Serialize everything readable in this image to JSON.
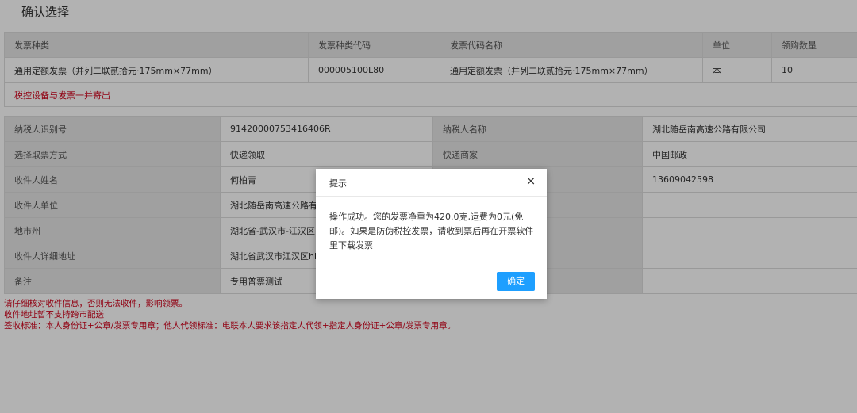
{
  "section": {
    "title": "确认选择"
  },
  "invoice_table": {
    "headers": [
      "发票种类",
      "发票种类代码",
      "发票代码名称",
      "单位",
      "领购数量"
    ],
    "rows": [
      [
        "通用定额发票（并列二联贰拾元·175mm×77mm）",
        "000005100L80",
        "通用定额发票（并列二联贰拾元·175mm×77mm）",
        "本",
        "10"
      ]
    ],
    "warning": "税控设备与发票一并寄出"
  },
  "info_table": {
    "rows": [
      {
        "label1": "纳税人识别号",
        "value1": "91420000753416406R",
        "label2": "纳税人名称",
        "value2": "湖北随岳南高速公路有限公司"
      },
      {
        "label1": "选择取票方式",
        "value1": "快递领取",
        "label2": "快递商家",
        "value2": "中国邮政"
      },
      {
        "label1": "收件人姓名",
        "value1": "何柏青",
        "label2": "",
        "value2": "13609042598"
      },
      {
        "label1": "收件人单位",
        "value1": "湖北随岳南高速公路有",
        "label2": "",
        "value2": ""
      },
      {
        "label1": "地市州",
        "value1": "湖北省-武汉市-江汉区",
        "label2": "",
        "value2": ""
      },
      {
        "label1": "收件人详细地址",
        "value1": "湖北省武汉市江汉区hk",
        "label2": "",
        "value2": ""
      },
      {
        "label1": "备注",
        "value1": "专用普票测试",
        "label2": "",
        "value2": ""
      }
    ]
  },
  "notes": [
    "请仔细核对收件信息，否则无法收件，影响领票。",
    "收件地址暂不支持跨市配送",
    "签收标准：本人身份证+公章/发票专用章；他人代领标准：电联本人要求该指定人代领+指定人身份证+公章/发票专用章。"
  ],
  "dialog": {
    "title": "提示",
    "close_icon": "×",
    "message": "操作成功。您的发票净重为420.0克,运费为0元(免邮)。如果是防伪税控发票，请收到票后再在开票软件里下载发票",
    "confirm_label": "确定"
  },
  "colors": {
    "accent": "#1e9fff",
    "warning": "#d0021b",
    "header_bg": "#e6e6e6"
  }
}
